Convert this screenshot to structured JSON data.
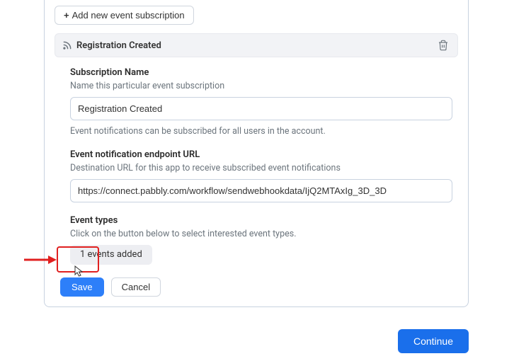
{
  "toolbar": {
    "add_label": "Add new event subscription"
  },
  "header": {
    "title": "Registration Created"
  },
  "subscription": {
    "label": "Subscription Name",
    "help": "Name this particular event subscription",
    "value": "Registration Created",
    "note": "Event notifications can be subscribed for all users in the account."
  },
  "endpoint": {
    "label": "Event notification endpoint URL",
    "help": "Destination URL for this app to receive subscribed event notifications",
    "value": "https://connect.pabbly.com/workflow/sendwebhookdata/IjQ2MTAxIg_3D_3D"
  },
  "eventtypes": {
    "label": "Event types",
    "help": "Click on the button below to select interested event types.",
    "chip": "1 events added"
  },
  "actions": {
    "save": "Save",
    "cancel": "Cancel"
  },
  "footer": {
    "continue": "Continue"
  }
}
